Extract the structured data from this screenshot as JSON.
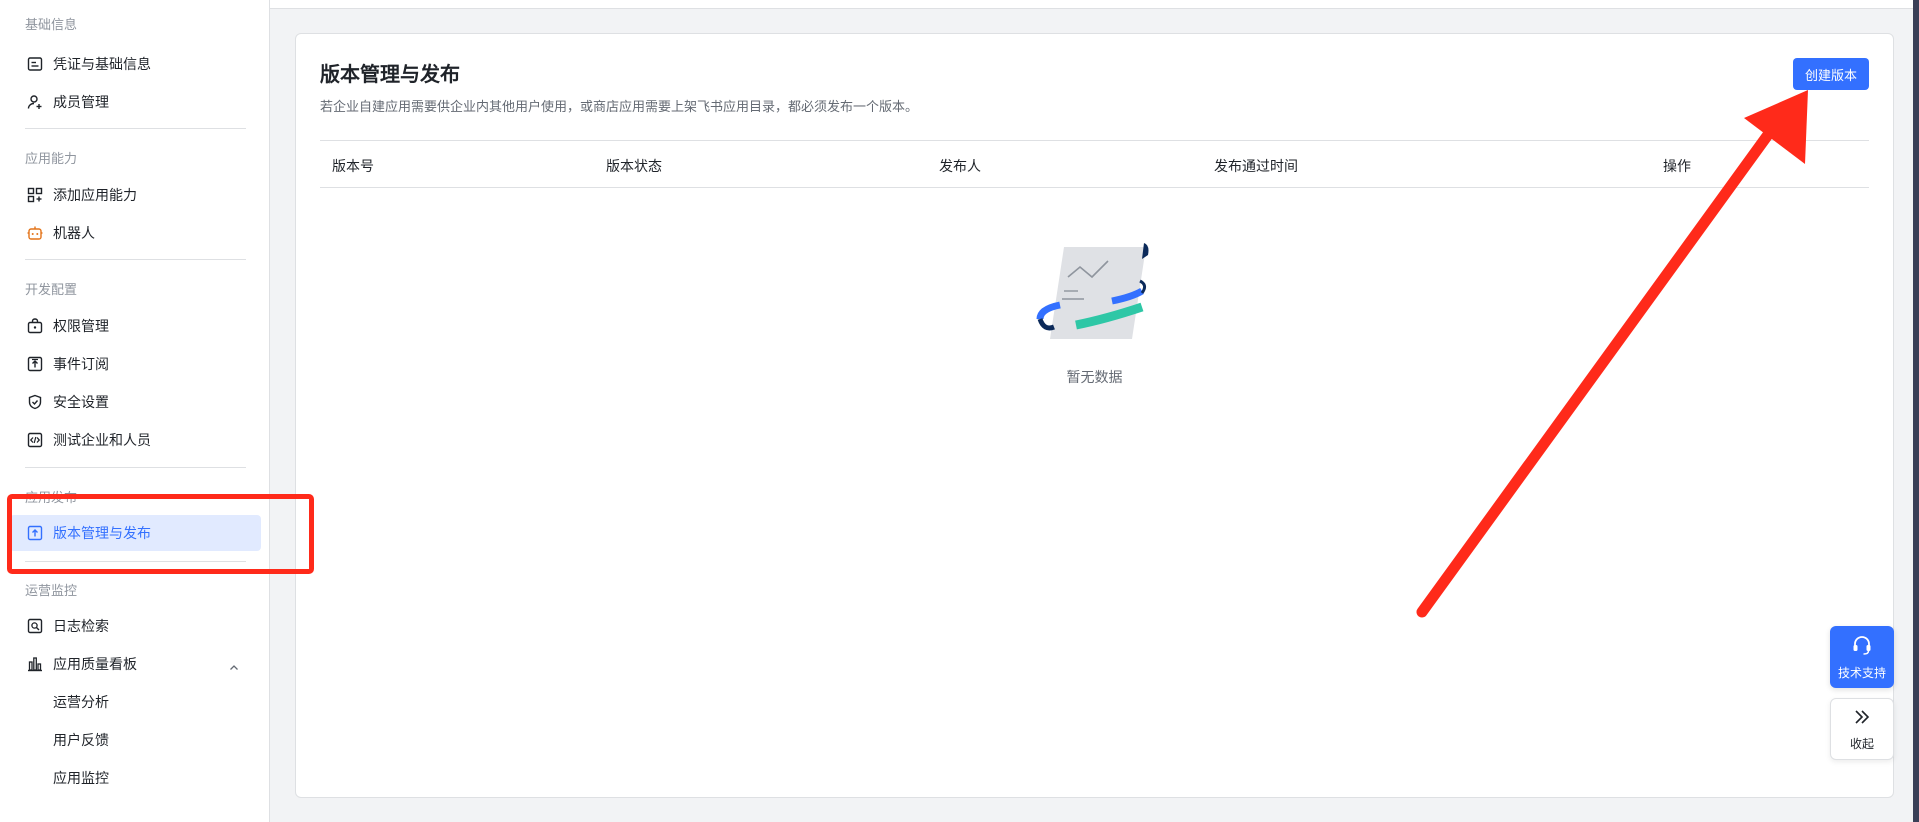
{
  "sidebar": {
    "groups": [
      {
        "title": "基础信息",
        "items": [
          {
            "label": "凭证与基础信息",
            "icon": "credential-icon"
          },
          {
            "label": "成员管理",
            "icon": "member-add-icon"
          }
        ]
      },
      {
        "title": "应用能力",
        "items": [
          {
            "label": "添加应用能力",
            "icon": "apps-add-icon"
          },
          {
            "label": "机器人",
            "icon": "robot-icon"
          }
        ]
      },
      {
        "title": "开发配置",
        "items": [
          {
            "label": "权限管理",
            "icon": "permission-icon"
          },
          {
            "label": "事件订阅",
            "icon": "event-subscribe-icon"
          },
          {
            "label": "安全设置",
            "icon": "shield-icon"
          },
          {
            "label": "测试企业和人员",
            "icon": "code-test-icon"
          }
        ]
      },
      {
        "title": "应用发布",
        "items": [
          {
            "label": "版本管理与发布",
            "icon": "upload-icon",
            "active": true
          }
        ]
      },
      {
        "title": "运营监控",
        "items": [
          {
            "label": "日志检索",
            "icon": "log-search-icon"
          },
          {
            "label": "应用质量看板",
            "icon": "bar-chart-icon"
          },
          {
            "label": "运营分析"
          },
          {
            "label": "用户反馈"
          },
          {
            "label": "应用监控"
          }
        ]
      }
    ]
  },
  "main": {
    "title": "版本管理与发布",
    "description": "若企业自建应用需要供企业内其他用户使用，或商店应用需要上架飞书应用目录，都必须发布一个版本。",
    "create_button": "创建版本",
    "columns": [
      "版本号",
      "版本状态",
      "发布人",
      "发布通过时间",
      "操作"
    ],
    "empty_text": "暂无数据"
  },
  "floating": {
    "support_label": "技术支持",
    "collapse_label": "收起"
  },
  "colors": {
    "accent": "#3370ff",
    "annotation": "#ff2a1a",
    "active_bg": "#e1eaff"
  }
}
